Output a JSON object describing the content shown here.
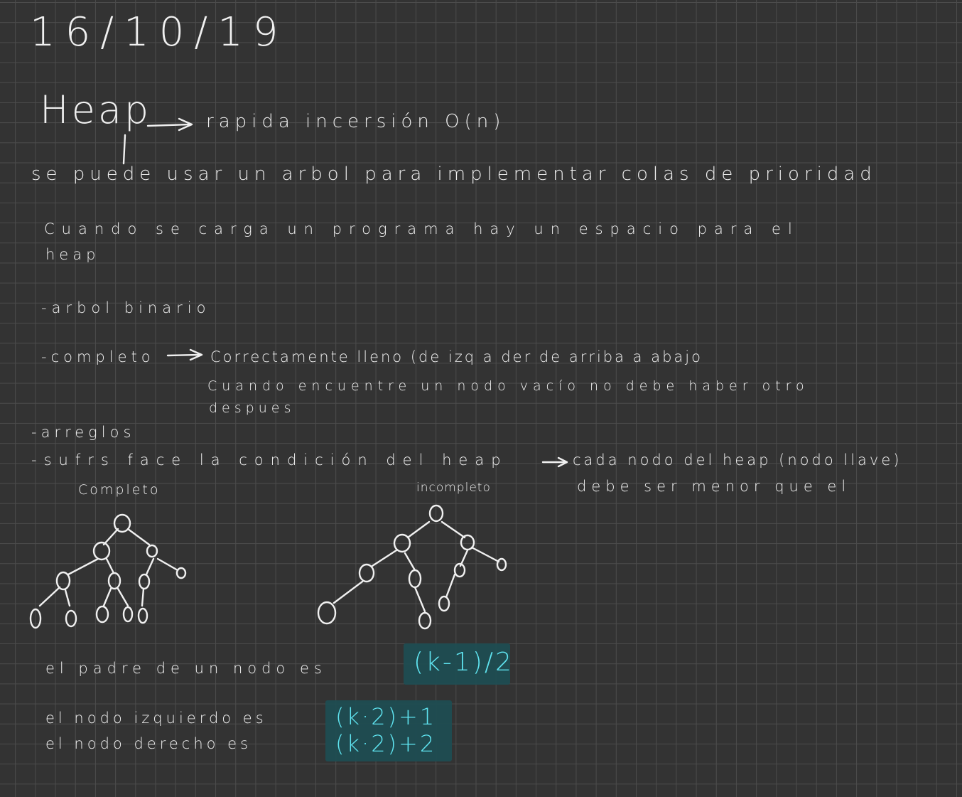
{
  "date": "16/10/19",
  "title": "Heap",
  "title_note": "rapida incersión O(n)",
  "lines": {
    "l1": "se puede usar un arbol para implementar colas de prioridad",
    "l2a": "Cuando se carga un programa hay un espacio para el",
    "l2b": "heap",
    "l3": "-arbol binario",
    "l4a": "-completo",
    "l4b": "Correctamente lleno (de izq a der de arriba a abajo",
    "l4c": "Cuando encuentre un nodo vacío no debe haber otro",
    "l4d": "despues",
    "l5": "-arreglos",
    "l6a": "-sufrs face la condición del heap",
    "l6b": "cada nodo del heap (nodo llave)",
    "l6c": "debe ser menor que el"
  },
  "tree_labels": {
    "left": "Completo",
    "right": "incompleto"
  },
  "formulas": {
    "parent_label": "el padre de un nodo es",
    "parent_formula": "(k-1)/2",
    "left_label": "el nodo izquierdo es",
    "left_formula": "(k·2)+1",
    "right_label": "el nodo derecho es",
    "right_formula": "(k·2)+2"
  },
  "colors": {
    "background": "#333333",
    "grid": "#4c4c4c",
    "ink": "#f0f0f0",
    "formula_ink": "#5fe4f0",
    "highlight": "#1f4d52"
  }
}
